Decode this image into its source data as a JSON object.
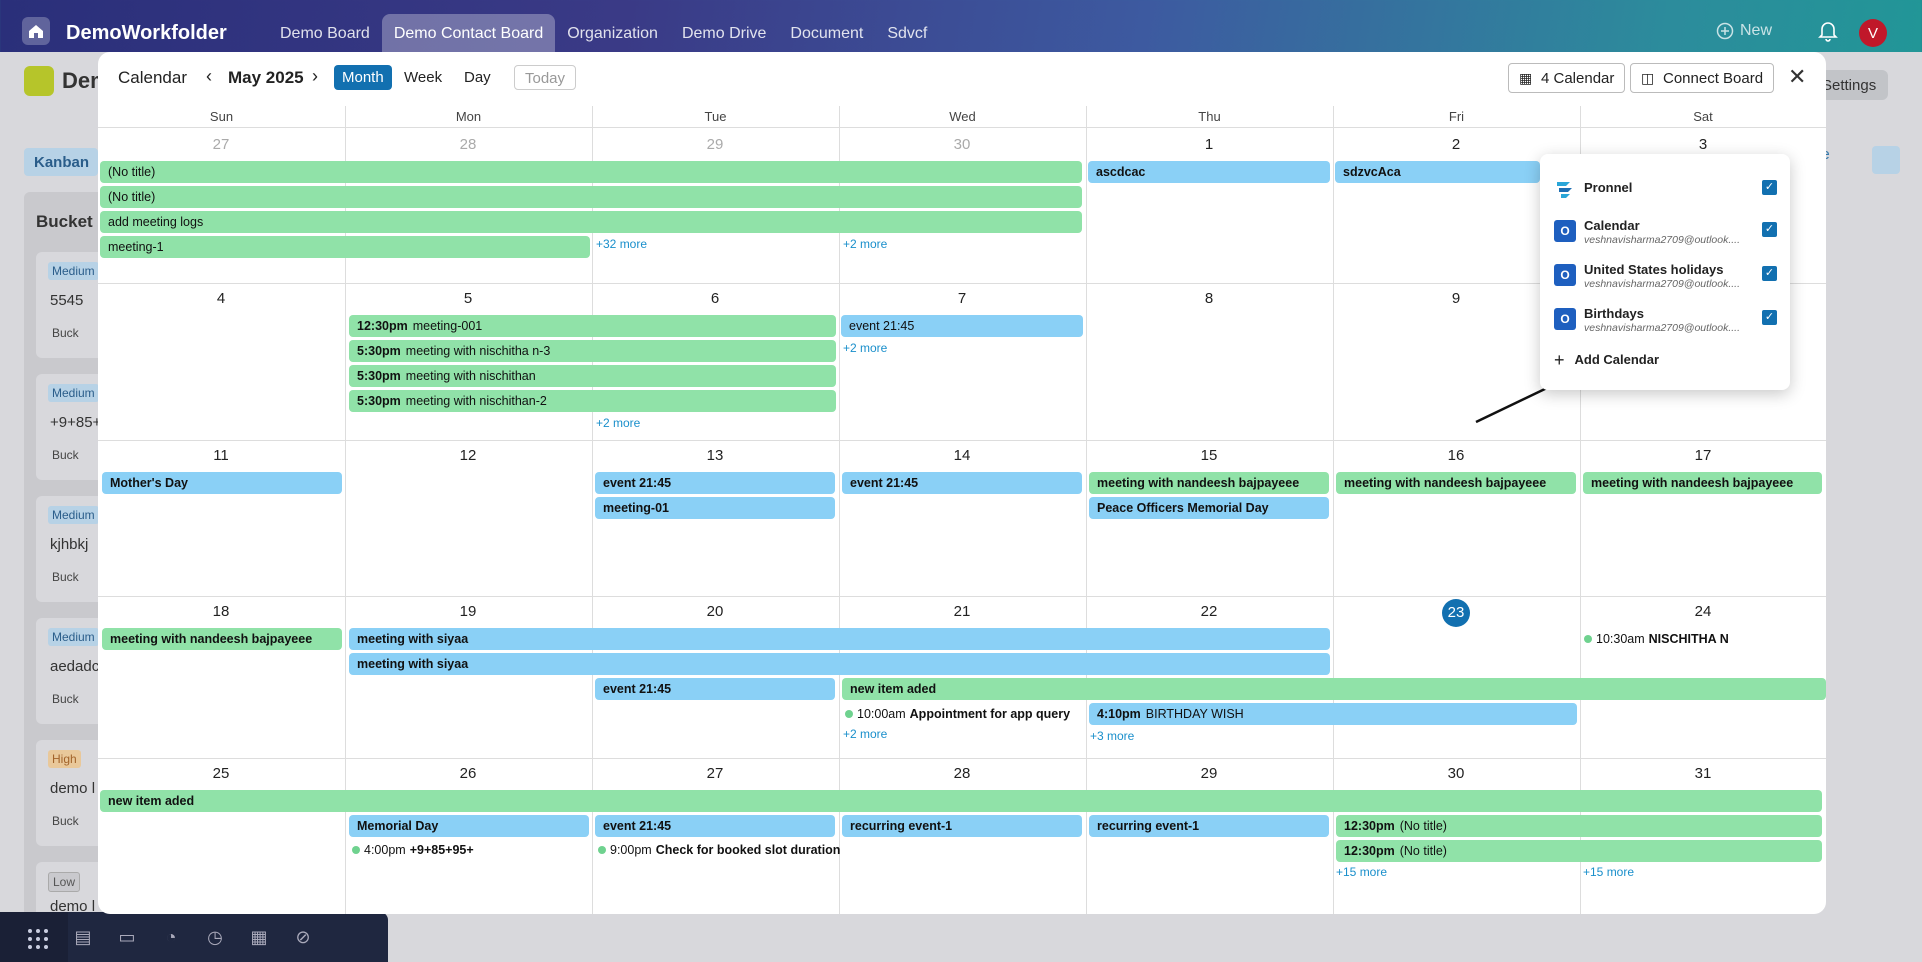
{
  "app": {
    "name": "DemoWorkfolder",
    "new_label": "New",
    "avatar_initial": "V"
  },
  "nav": [
    "Demo Board",
    "Demo Contact Board",
    "Organization",
    "Demo Drive",
    "Document",
    "Sdvcf"
  ],
  "background": {
    "board_title": "Dem",
    "kanban": "Kanban",
    "bucket": "Bucket",
    "settings": "Settings",
    "more": "ore",
    "cards": [
      {
        "badge": "Medium",
        "text": "5545",
        "bucket": "Buck"
      },
      {
        "badge": "Medium",
        "text": "+9+85+",
        "bucket": "Buck"
      },
      {
        "badge": "Medium",
        "text": "kjhbkj",
        "bucket": "Buck"
      },
      {
        "badge": "Medium",
        "text": "aedadc",
        "bucket": "Buck"
      },
      {
        "badge": "High",
        "text": "demo l",
        "bucket": "Buck"
      },
      {
        "badge": "Low",
        "text": "demo l",
        "bucket": ""
      }
    ]
  },
  "calendar": {
    "title": "Calendar",
    "month": "May 2025",
    "views": [
      "Month",
      "Week",
      "Day"
    ],
    "today_label": "Today",
    "calendars_btn": "4 Calendar",
    "connect_btn": "Connect Board",
    "weekdays": [
      "Sun",
      "Mon",
      "Tue",
      "Wed",
      "Thu",
      "Fri",
      "Sat"
    ],
    "weeks": [
      [
        "27",
        "28",
        "29",
        "30",
        "1",
        "2",
        "3"
      ],
      [
        "4",
        "5",
        "6",
        "7",
        "8",
        "9",
        "10"
      ],
      [
        "11",
        "12",
        "13",
        "14",
        "15",
        "16",
        "17"
      ],
      [
        "18",
        "19",
        "20",
        "21",
        "22",
        "23",
        "24"
      ],
      [
        "25",
        "26",
        "27",
        "28",
        "29",
        "30",
        "31"
      ]
    ],
    "events": {
      "w1": [
        "(No title)",
        "(No title)",
        "add meeting logs",
        "meeting-1",
        "ascdcac",
        "sdzvcAca"
      ],
      "w1_more": [
        "+32 more",
        "+2 more"
      ],
      "w2": [
        {
          "time": "12:30pm",
          "title": "meeting-001"
        },
        {
          "time": "5:30pm",
          "title": "meeting with nischitha n-3"
        },
        {
          "time": "5:30pm",
          "title": "meeting with nischithan"
        },
        {
          "time": "5:30pm",
          "title": "meeting with nischithan-2"
        },
        {
          "time": "",
          "title": "event 21:45"
        }
      ],
      "w2_more": [
        "+2 more",
        "+2 more"
      ],
      "w3": [
        "Mother's Day",
        "event 21:45",
        "meeting-01",
        "event 21:45",
        "meeting with nandeesh bajpayeee",
        "Peace Officers Memorial Day",
        "meeting with nandeesh bajpayeee",
        "meeting with nandeesh bajpayeee"
      ],
      "w4": {
        "sun": "meeting with nandeesh bajpayeee",
        "siyaa1": "meeting with siyaa",
        "siyaa2": "meeting with siyaa",
        "tue": "event 21:45",
        "new_item": "new item aded",
        "appt_time": "10:00am",
        "appt_title": "Appointment for app query",
        "bday_time": "4:10pm",
        "bday_title": "BIRTHDAY WISH",
        "sat_time": "10:30am",
        "sat_title": "NISCHITHA N",
        "more_wed": "+2 more",
        "more_thu": "+3 more"
      },
      "w5": {
        "new_item": "new item aded",
        "memorial": "Memorial Day",
        "mon_time": "4:00pm",
        "mon_title": "+9+85+95+",
        "tue_event": "event 21:45",
        "tue_time": "9:00pm",
        "tue_title": "Check for booked slot duration",
        "wed": "recurring event-1",
        "thu": "recurring event-1",
        "fri_time1": "12:30pm",
        "fri_title1": "(No title)",
        "fri_time2": "12:30pm",
        "fri_title2": "(No title)",
        "more_fri": "+15 more",
        "more_sat": "+15 more"
      }
    },
    "calendar_list": [
      {
        "name": "Pronnel",
        "sub": ""
      },
      {
        "name": "Calendar",
        "sub": "veshnavisharma2709@outlook...."
      },
      {
        "name": "United States holidays",
        "sub": "veshnavisharma2709@outlook...."
      },
      {
        "name": "Birthdays",
        "sub": "veshnavisharma2709@outlook...."
      }
    ],
    "add_calendar": "Add Calendar"
  }
}
